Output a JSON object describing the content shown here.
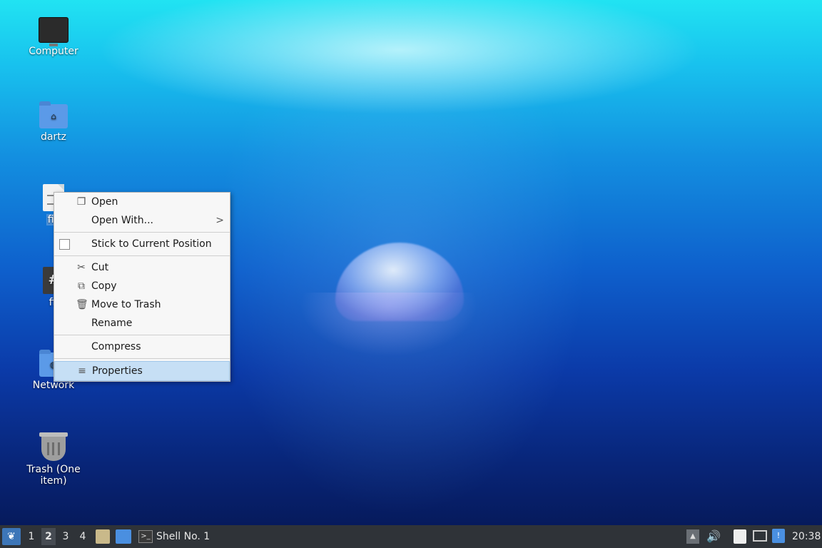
{
  "desktop": {
    "icons": [
      {
        "label": "Computer",
        "icon": "computer-icon"
      },
      {
        "label": "dartz",
        "icon": "home-folder-icon"
      },
      {
        "label": "fill",
        "icon": "text-file-icon"
      },
      {
        "label": "fil",
        "icon": "hash-file-icon"
      },
      {
        "label": "Network",
        "icon": "network-icon"
      },
      {
        "label": "Trash (One item)",
        "icon": "trash-icon"
      }
    ]
  },
  "context_menu": {
    "items": {
      "open": {
        "label": "Open",
        "icon": "open-icon"
      },
      "open_with": {
        "label": "Open With...",
        "arrow": ">"
      },
      "stick": {
        "label": "Stick to Current Position"
      },
      "cut": {
        "label": "Cut",
        "icon": "scissors-icon",
        "glyph": "✂"
      },
      "copy": {
        "label": "Copy",
        "icon": "copy-icon",
        "glyph": "⧉"
      },
      "trash": {
        "label": "Move to Trash",
        "icon": "trash-icon",
        "glyph": "🗑"
      },
      "rename": {
        "label": "Rename"
      },
      "compress": {
        "label": "Compress"
      },
      "properties": {
        "label": "Properties",
        "icon": "properties-icon",
        "glyph": "≡"
      }
    },
    "highlighted": "Properties"
  },
  "taskbar": {
    "workspaces": [
      "1",
      "2",
      "3",
      "4"
    ],
    "active_workspace": "2",
    "task_label": "Shell No. 1",
    "clock": "20:38",
    "accent": "#3d76b8"
  }
}
